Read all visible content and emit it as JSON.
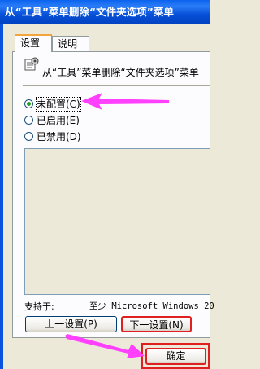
{
  "window": {
    "title": "从“工具”菜单删除“文件夹选项”菜单"
  },
  "tabs": [
    {
      "label": "设置"
    },
    {
      "label": "说明"
    }
  ],
  "policy": {
    "name": "从“工具”菜单删除“文件夹选项”菜单"
  },
  "options": [
    {
      "label": "未配置(C)",
      "checked": true
    },
    {
      "label": "已启用(E)",
      "checked": false
    },
    {
      "label": "已禁用(D)",
      "checked": false
    }
  ],
  "support": {
    "label": "支持于:",
    "value": "至少 Microsoft Windows 20"
  },
  "buttons": {
    "prev": "上一设置(P)",
    "next": "下一设置(N)",
    "ok": "确定"
  },
  "colors": {
    "titlebar": "#0a62ee",
    "dialog": "#ece9d8",
    "annotation_arrow": "#ff40ff",
    "annotation_box": "#e02020",
    "radio_dot": "#21a121"
  },
  "icons": {
    "policy": "policy-settings-icon"
  }
}
